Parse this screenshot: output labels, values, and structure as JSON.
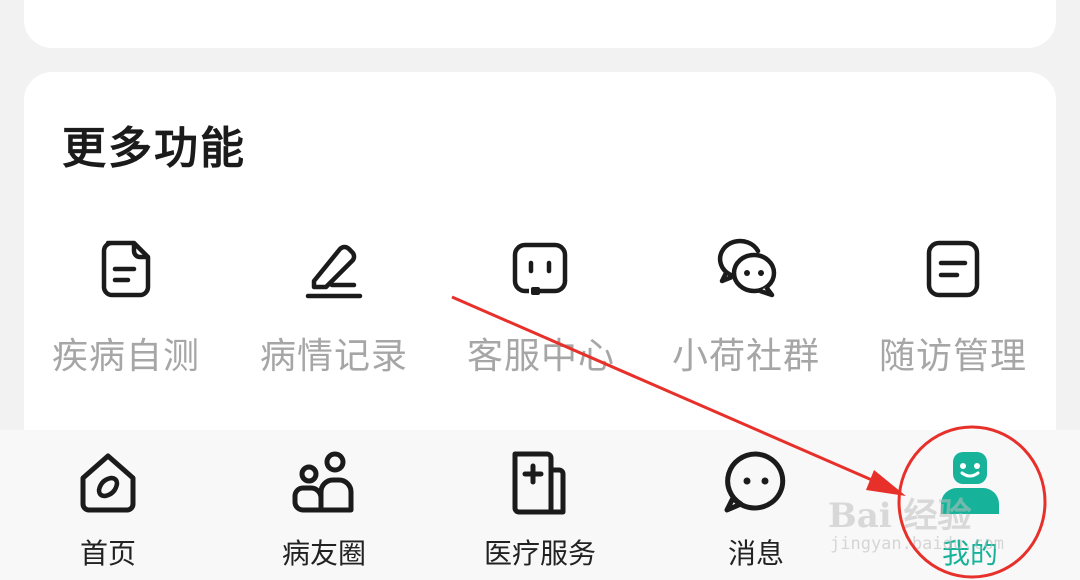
{
  "section": {
    "title": "更多功能"
  },
  "features": [
    {
      "label": "疾病自测",
      "icon": "document-icon"
    },
    {
      "label": "病情记录",
      "icon": "pen-edit-icon"
    },
    {
      "label": "客服中心",
      "icon": "headset-face-icon"
    },
    {
      "label": "小荷社群",
      "icon": "chat-bubbles-icon"
    },
    {
      "label": "随访管理",
      "icon": "memo-icon"
    }
  ],
  "bottom_nav": [
    {
      "label": "首页",
      "icon": "home-icon"
    },
    {
      "label": "病友圈",
      "icon": "community-icon"
    },
    {
      "label": "医疗服务",
      "icon": "medical-doc-icon"
    },
    {
      "label": "消息",
      "icon": "message-icon"
    },
    {
      "label": "我的",
      "icon": "profile-icon",
      "active": true
    }
  ],
  "watermark": {
    "main": "Bai 经验",
    "sub": "jingyan.baidu.com"
  },
  "colors": {
    "accent": "#16b39a",
    "annotation": "#e8302a",
    "icon_stroke": "#1b1b1b"
  }
}
